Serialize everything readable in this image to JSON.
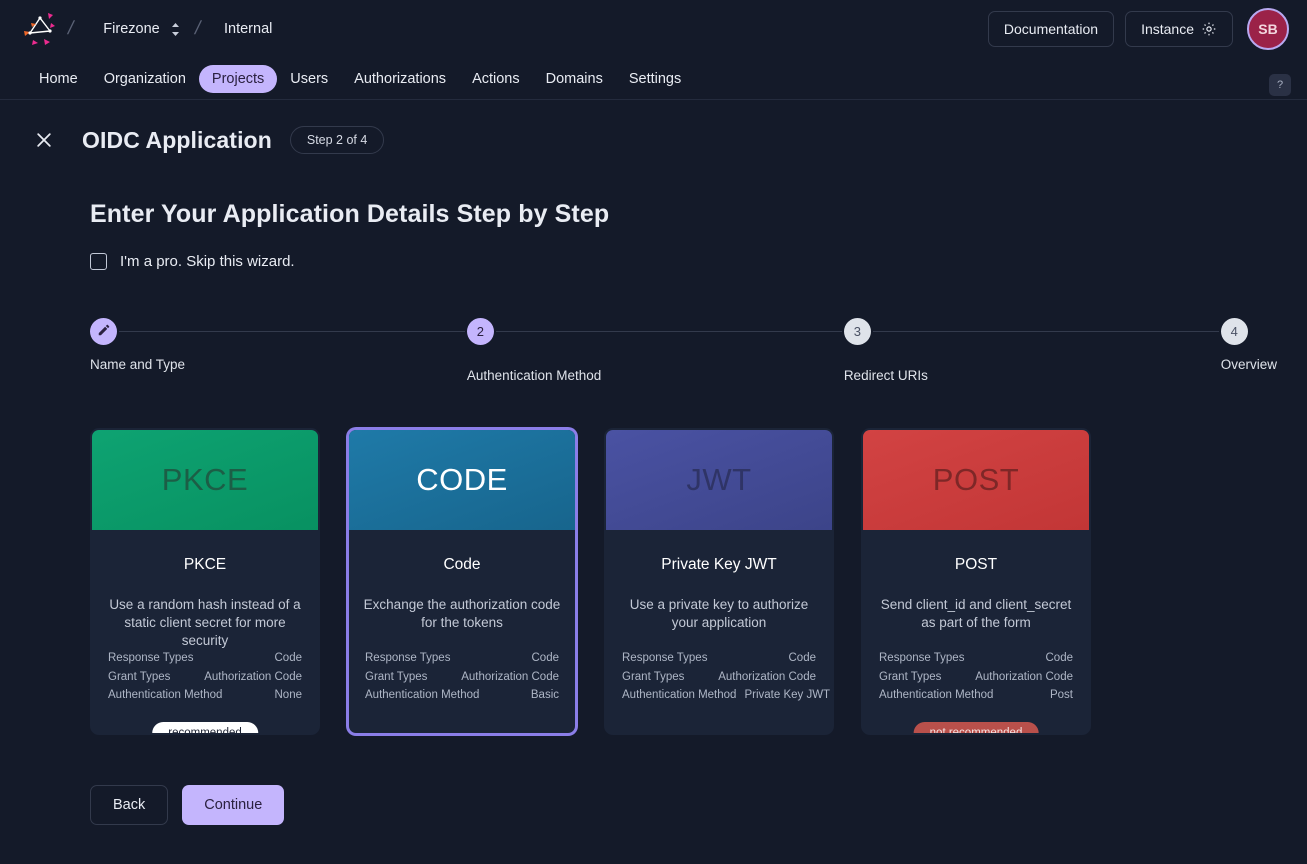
{
  "topbar": {
    "logo_alt": "firezone-logo",
    "org": "Firezone",
    "project": "Internal",
    "separator": "/",
    "documentation_label": "Documentation",
    "instance_label": "Instance",
    "avatar_initials": "SB"
  },
  "nav": {
    "items": [
      {
        "label": "Home",
        "active": false
      },
      {
        "label": "Organization",
        "active": false
      },
      {
        "label": "Projects",
        "active": true
      },
      {
        "label": "Users",
        "active": false
      },
      {
        "label": "Authorizations",
        "active": false
      },
      {
        "label": "Actions",
        "active": false
      },
      {
        "label": "Domains",
        "active": false
      },
      {
        "label": "Settings",
        "active": false
      }
    ],
    "help_label": "?"
  },
  "wizard": {
    "title": "OIDC Application",
    "step_badge": "Step 2 of 4",
    "headline": "Enter Your Application Details Step by Step",
    "skip_label": "I'm a pro. Skip this wizard.",
    "skip_checked": false,
    "steps": [
      {
        "number": "1",
        "label": "Name and Type",
        "state": "done",
        "glyph": "pencil"
      },
      {
        "number": "2",
        "label": "Authentication Method",
        "state": "current",
        "glyph": "number"
      },
      {
        "number": "3",
        "label": "Redirect URIs",
        "state": "todo",
        "glyph": "number"
      },
      {
        "number": "4",
        "label": "Overview",
        "state": "todo",
        "glyph": "number"
      }
    ],
    "back_label": "Back",
    "continue_label": "Continue"
  },
  "spec_labels": {
    "response_types": "Response Types",
    "grant_types": "Grant Types",
    "authentication_method": "Authentication Method"
  },
  "cards": [
    {
      "banner": "PKCE",
      "title": "PKCE",
      "description": "Use a random hash instead of a static client secret for more security",
      "response_types": "Code",
      "grant_types": "Authorization Code",
      "auth_method": "None",
      "badge": "recommended",
      "badge_kind": "recommended",
      "selected": false,
      "accent": "#099265"
    },
    {
      "banner": "CODE",
      "title": "Code",
      "description": "Exchange the authorization code for the tokens",
      "response_types": "Code",
      "grant_types": "Authorization Code",
      "auth_method": "Basic",
      "badge": "",
      "badge_kind": "none",
      "selected": true,
      "accent": "#1a6b96"
    },
    {
      "banner": "JWT",
      "title": "Private Key JWT",
      "description": "Use a private key to authorize your application",
      "response_types": "Code",
      "grant_types": "Authorization Code",
      "auth_method": "Private Key JWT",
      "badge": "",
      "badge_kind": "none",
      "selected": false,
      "accent": "#434a96"
    },
    {
      "banner": "POST",
      "title": "POST",
      "description": "Send client_id and client_secret as part of the form",
      "response_types": "Code",
      "grant_types": "Authorization Code",
      "auth_method": "Post",
      "badge": "not recommended",
      "badge_kind": "not-recommended",
      "selected": false,
      "accent": "#cc3a3a"
    }
  ],
  "colors": {
    "page_bg": "#141a29",
    "card_bg": "#1b2437",
    "accent_purple": "#c4b5fd",
    "selected_border": "#8b7ee8"
  }
}
